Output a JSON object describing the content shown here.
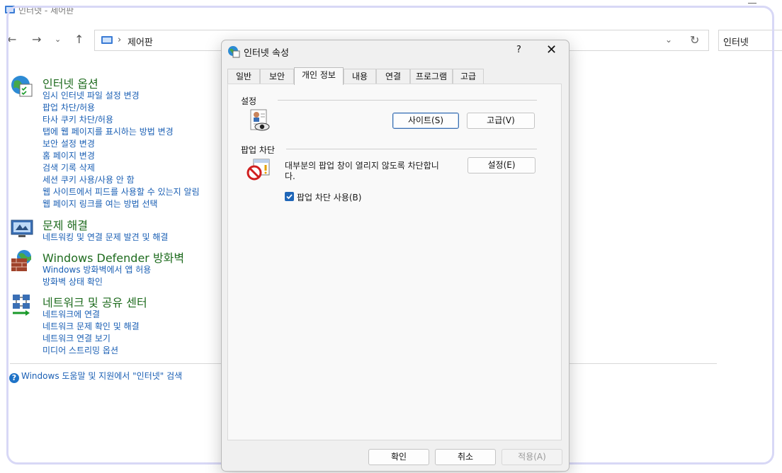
{
  "window": {
    "title": "인터넷 - 제어판"
  },
  "address_bar": {
    "path_separator": "›",
    "path": "제어판",
    "search_value": "인터넷"
  },
  "sections": [
    {
      "title": "인터넷 옵션",
      "icon": "internet-options-icon",
      "links": [
        "임시 인터넷 파일 설정 변경",
        "팝업 차단/허용",
        "타사 쿠키 차단/허용",
        "탭에 웹 페이지를 표시하는 방법 변경",
        "보안 설정 변경",
        "홈 페이지 변경",
        "검색 기록 삭제",
        "세션 쿠키 사용/사용 안 함",
        "웹 사이트에서 피드를 사용할 수 있는지 알림",
        "웹 페이지 링크를 여는 방법 선택"
      ]
    },
    {
      "title": "문제 해결",
      "icon": "troubleshooting-icon",
      "links": [
        "네트워킹 및 연결 문제 발견 및 해결"
      ]
    },
    {
      "title": "Windows Defender 방화벽",
      "icon": "firewall-icon",
      "links": [
        "Windows 방화벽에서 앱 허용",
        "방화벽 상태 확인"
      ]
    },
    {
      "title": "네트워크 및 공유 센터",
      "icon": "network-center-icon",
      "links": [
        "네트워크에 연결",
        "네트워크 문제 확인 및 해결",
        "네트워크 연결 보기",
        "미디어 스트리밍 옵션"
      ]
    }
  ],
  "help_link": "Windows 도움말 및 지원에서 \"인터넷\" 검색",
  "help_icon_glyph": "?",
  "dialog": {
    "title": "인터넷 속성",
    "help_glyph": "?",
    "close_glyph": "✕",
    "tabs": [
      "일반",
      "보안",
      "개인 정보",
      "내용",
      "연결",
      "프로그램",
      "고급"
    ],
    "active_tab": "개인 정보",
    "settings_group": {
      "label": "설정",
      "sites_button": "사이트(S)",
      "advanced_button": "고급(V)"
    },
    "popup_group": {
      "label": "팝업 차단",
      "description": "대부분의 팝업 창이 열리지 않도록 차단합니다.",
      "settings_button": "설정(E)",
      "checkbox_label": "팝업 차단 사용(B)",
      "checkbox_checked": true
    },
    "footer": {
      "ok": "확인",
      "cancel": "취소",
      "apply": "적용(A)"
    }
  },
  "colors": {
    "section_title": "#1e6b1e",
    "link": "#1a5fb4",
    "accent": "#1f66b8"
  }
}
